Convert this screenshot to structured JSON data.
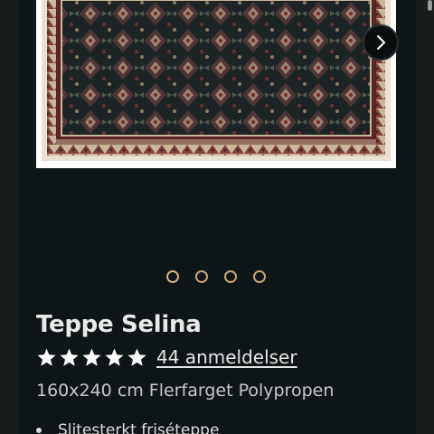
{
  "product": {
    "title": "Teppe Selina",
    "stars": 5,
    "reviews_label": "44 anmeldelser",
    "subtitle": "160x240 cm Flerfarget Polypropen"
  },
  "carousel": {
    "slide_count": 4,
    "active_index": 0,
    "next_icon": "chevron-right-icon"
  },
  "features": [
    "Slitesterkt friséteppe"
  ],
  "colors": {
    "background": "#0f1617",
    "accent_dot": "#c4a371",
    "text": "#e9e9e9",
    "rug_dark": "#1d2426",
    "rug_red": "#7a2a2a"
  }
}
